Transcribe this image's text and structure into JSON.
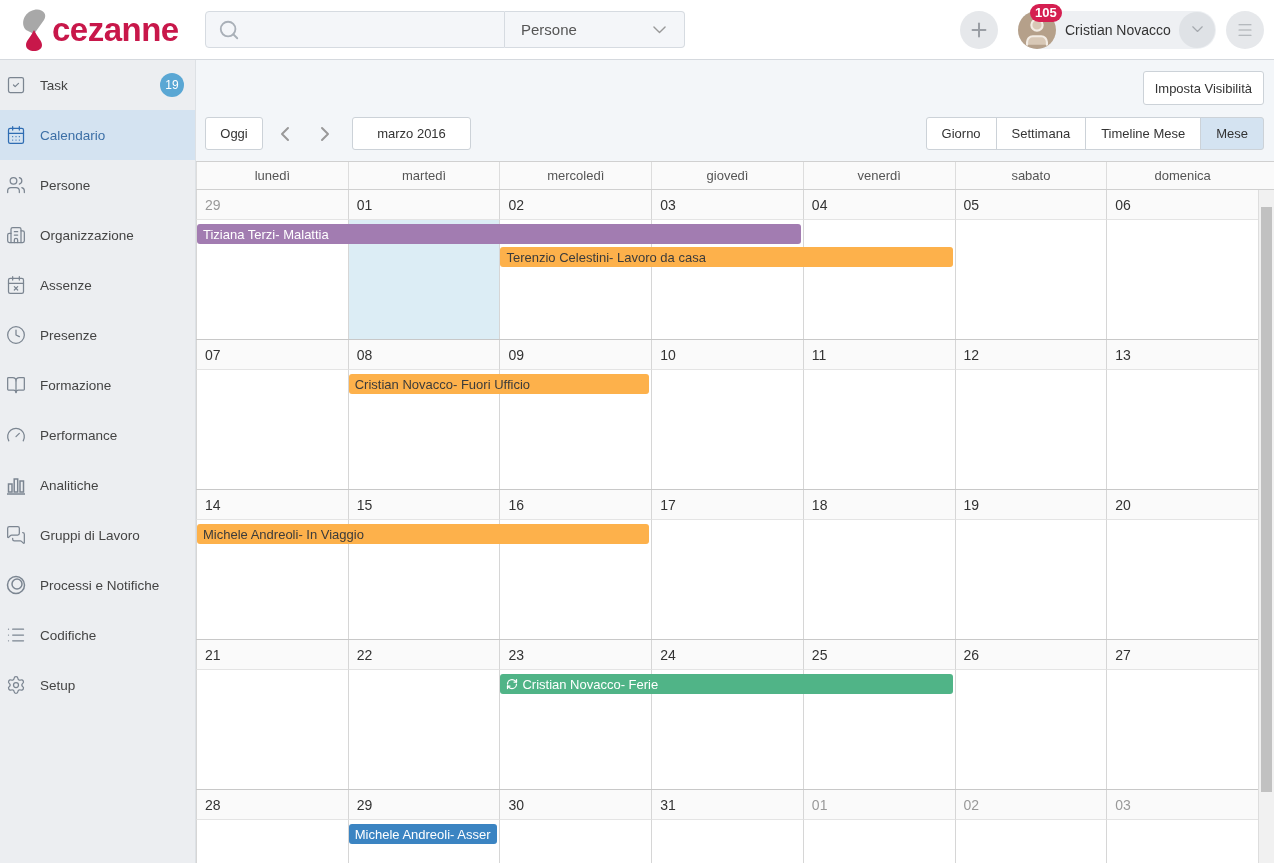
{
  "header": {
    "logo": "cezanne",
    "search": {
      "scope": "Persone"
    },
    "user": {
      "name": "Cristian Novacco",
      "notifications": "105"
    }
  },
  "sidebar": {
    "items": [
      {
        "label": "Task",
        "badge": "19",
        "selected": false
      },
      {
        "label": "Calendario",
        "selected": true
      },
      {
        "label": "Persone",
        "selected": false
      },
      {
        "label": "Organizzazione",
        "selected": false
      },
      {
        "label": "Assenze",
        "selected": false
      },
      {
        "label": "Presenze",
        "selected": false
      },
      {
        "label": "Formazione",
        "selected": false
      },
      {
        "label": "Performance",
        "selected": false
      },
      {
        "label": "Analitiche",
        "selected": false
      },
      {
        "label": "Gruppi di Lavoro",
        "selected": false
      },
      {
        "label": "Processi e Notifiche",
        "selected": false
      },
      {
        "label": "Codifiche",
        "selected": false
      },
      {
        "label": "Setup",
        "selected": false
      }
    ]
  },
  "toolbar": {
    "visibility_button": "Imposta Visibilità",
    "today_button": "Oggi",
    "period": "marzo 2016",
    "views": [
      {
        "label": "Giorno",
        "selected": false
      },
      {
        "label": "Settimana",
        "selected": false
      },
      {
        "label": "Timeline Mese",
        "selected": false
      },
      {
        "label": "Mese",
        "selected": true
      }
    ]
  },
  "calendar": {
    "weekdays": [
      "lunedì",
      "martedì",
      "mercoledì",
      "giovedì",
      "venerdì",
      "sabato",
      "domenica"
    ],
    "weeks": [
      {
        "days": [
          {
            "number": "29",
            "other_month": true,
            "today": false
          },
          {
            "number": "01",
            "other_month": false,
            "today": true
          },
          {
            "number": "02",
            "other_month": false,
            "today": false
          },
          {
            "number": "03",
            "other_month": false,
            "today": false
          },
          {
            "number": "04",
            "other_month": false,
            "today": false
          },
          {
            "number": "05",
            "other_month": false,
            "today": false
          },
          {
            "number": "06",
            "other_month": false,
            "today": false
          }
        ],
        "lanes": [
          [
            {
              "kind": "start",
              "label": "Tiziana Terzi- Malattia",
              "color": "#a27cb1",
              "in_progress": false
            },
            {
              "kind": "continue"
            },
            {
              "kind": "continue"
            },
            {
              "kind": "continue"
            },
            {
              "kind": "empty"
            },
            {
              "kind": "empty"
            },
            {
              "kind": "empty"
            }
          ],
          [
            {
              "kind": "empty"
            },
            {
              "kind": "empty"
            },
            {
              "kind": "start",
              "label": "Terenzio Celestini- Lavoro da casa",
              "color": "#fdb14b",
              "in_progress": false
            },
            {
              "kind": "continue"
            },
            {
              "kind": "continue"
            },
            {
              "kind": "empty"
            },
            {
              "kind": "empty"
            }
          ]
        ]
      },
      {
        "days": [
          {
            "number": "07",
            "other_month": false,
            "today": false
          },
          {
            "number": "08",
            "other_month": false,
            "today": false
          },
          {
            "number": "09",
            "other_month": false,
            "today": false
          },
          {
            "number": "10",
            "other_month": false,
            "today": false
          },
          {
            "number": "11",
            "other_month": false,
            "today": false
          },
          {
            "number": "12",
            "other_month": false,
            "today": false
          },
          {
            "number": "13",
            "other_month": false,
            "today": false
          }
        ],
        "lanes": [
          [
            {
              "kind": "empty"
            },
            {
              "kind": "start",
              "label": "Cristian Novacco- Fuori Ufficio",
              "color": "#fdb14b",
              "in_progress": false
            },
            {
              "kind": "continue"
            },
            {
              "kind": "empty"
            },
            {
              "kind": "empty"
            },
            {
              "kind": "empty"
            },
            {
              "kind": "empty"
            }
          ]
        ]
      },
      {
        "days": [
          {
            "number": "14",
            "other_month": false,
            "today": false
          },
          {
            "number": "15",
            "other_month": false,
            "today": false
          },
          {
            "number": "16",
            "other_month": false,
            "today": false
          },
          {
            "number": "17",
            "other_month": false,
            "today": false
          },
          {
            "number": "18",
            "other_month": false,
            "today": false
          },
          {
            "number": "19",
            "other_month": false,
            "today": false
          },
          {
            "number": "20",
            "other_month": false,
            "today": false
          }
        ],
        "lanes": [
          [
            {
              "kind": "start",
              "label": "Michele Andreoli- In Viaggio",
              "color": "#fdb14b",
              "in_progress": false
            },
            {
              "kind": "continue"
            },
            {
              "kind": "continue"
            },
            {
              "kind": "empty"
            },
            {
              "kind": "empty"
            },
            {
              "kind": "empty"
            },
            {
              "kind": "empty"
            }
          ]
        ]
      },
      {
        "days": [
          {
            "number": "21",
            "other_month": false,
            "today": false
          },
          {
            "number": "22",
            "other_month": false,
            "today": false
          },
          {
            "number": "23",
            "other_month": false,
            "today": false
          },
          {
            "number": "24",
            "other_month": false,
            "today": false
          },
          {
            "number": "25",
            "other_month": false,
            "today": false
          },
          {
            "number": "26",
            "other_month": false,
            "today": false
          },
          {
            "number": "27",
            "other_month": false,
            "today": false
          }
        ],
        "lanes": [
          [
            {
              "kind": "empty"
            },
            {
              "kind": "empty"
            },
            {
              "kind": "start",
              "label": "Cristian Novacco- Ferie",
              "color": "#50b487",
              "in_progress": true
            },
            {
              "kind": "continue"
            },
            {
              "kind": "continue"
            },
            {
              "kind": "empty"
            },
            {
              "kind": "empty"
            }
          ]
        ]
      },
      {
        "days": [
          {
            "number": "28",
            "other_month": false,
            "today": false
          },
          {
            "number": "29",
            "other_month": false,
            "today": false
          },
          {
            "number": "30",
            "other_month": false,
            "today": false
          },
          {
            "number": "31",
            "other_month": false,
            "today": false
          },
          {
            "number": "01",
            "other_month": true,
            "today": false
          },
          {
            "number": "02",
            "other_month": true,
            "today": false
          },
          {
            "number": "03",
            "other_month": true,
            "today": false
          }
        ],
        "lanes": [
          [
            {
              "kind": "empty"
            },
            {
              "kind": "start",
              "label": "Michele Andreoli- Asser",
              "color": "#3b84c2",
              "in_progress": false
            },
            {
              "kind": "empty"
            },
            {
              "kind": "empty"
            },
            {
              "kind": "empty"
            },
            {
              "kind": "empty"
            },
            {
              "kind": "empty"
            }
          ]
        ]
      }
    ]
  }
}
